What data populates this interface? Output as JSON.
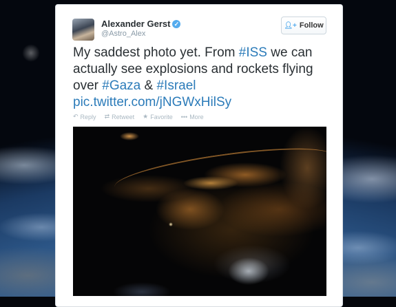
{
  "tweet": {
    "author_name": "Alexander Gerst",
    "author_handle": "@Astro_Alex",
    "follow_label": "Follow",
    "text_part1": "My saddest photo yet. From ",
    "hashtag_iss": "#ISS",
    "text_part2": " we can actually see explosions and rockets flying over ",
    "hashtag_gaza": "#Gaza",
    "text_part3": " & ",
    "hashtag_israel": "#Israel",
    "link": "pic.twitter.com/jNGWxHilSy",
    "actions": {
      "reply": "Reply",
      "retweet": "Retweet",
      "favorite": "Favorite",
      "more": "More"
    }
  },
  "icons": {
    "verified": "verified-badge-icon",
    "follow": "add-user-icon",
    "reply": "reply-icon",
    "retweet": "retweet-icon",
    "favorite": "star-icon",
    "more": "ellipsis-icon"
  },
  "colors": {
    "link": "#2b7bb9",
    "verified": "#55acee",
    "muted": "#8899a6"
  }
}
